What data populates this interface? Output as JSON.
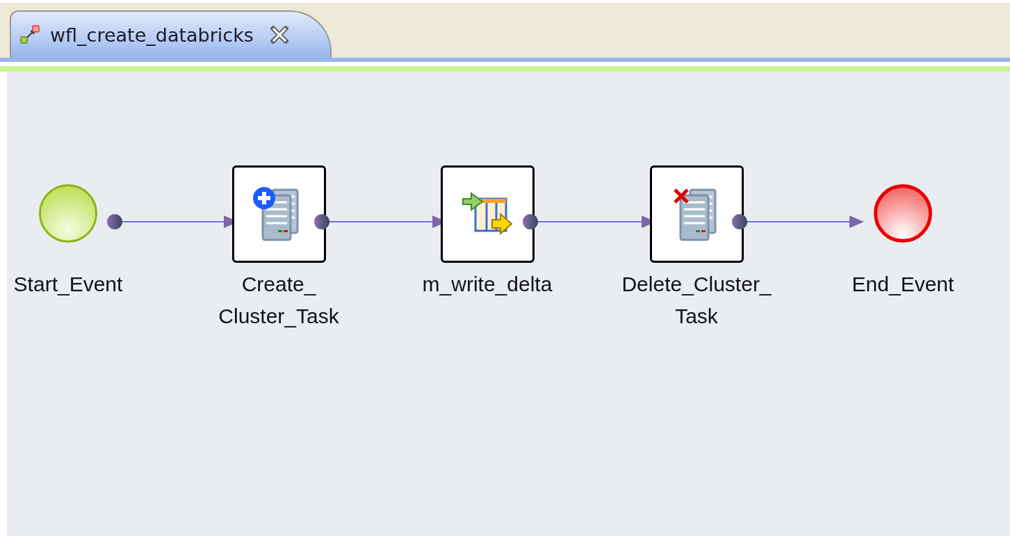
{
  "tab": {
    "title": "wfl_create_databricks",
    "selected": true,
    "closable": true
  },
  "nodes": [
    {
      "kind": "start",
      "label": "Start_Event"
    },
    {
      "kind": "create_task",
      "label": "Create_\nCluster_Task"
    },
    {
      "kind": "mapping",
      "label": "m_write_delta"
    },
    {
      "kind": "delete_task",
      "label": "Delete_Cluster_\nTask"
    },
    {
      "kind": "end",
      "label": "End_Event"
    }
  ]
}
